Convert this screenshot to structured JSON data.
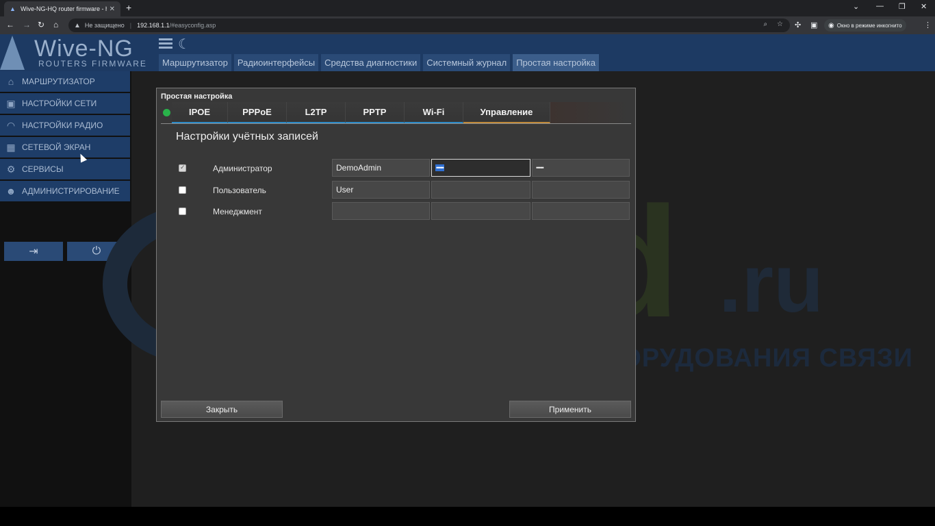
{
  "browser": {
    "tab_title": "Wive-NG-HQ router firmware - h",
    "address": {
      "security": "Не защищено",
      "host": "192.168.1.1",
      "path": "/#easyconfig.asp"
    },
    "incognito_label": "Окно в режиме инкогнито"
  },
  "logo": {
    "main": "Wive-NG",
    "sub": "ROUTERS FIRMWARE"
  },
  "topnav": [
    {
      "label": "Маршрутизатор"
    },
    {
      "label": "Радиоинтерфейсы"
    },
    {
      "label": "Средства диагностики"
    },
    {
      "label": "Системный журнал"
    },
    {
      "label": "Простая настройка"
    }
  ],
  "sidebar": {
    "items": [
      {
        "label": "МАРШРУТИЗАТОР",
        "icon": "home-icon"
      },
      {
        "label": "НАСТРОЙКИ СЕТИ",
        "icon": "network-icon"
      },
      {
        "label": "НАСТРОЙКИ РАДИО",
        "icon": "wifi-icon"
      },
      {
        "label": "СЕТЕВОЙ ЭКРАН",
        "icon": "firewall-icon"
      },
      {
        "label": "СЕРВИСЫ",
        "icon": "gear-icon"
      },
      {
        "label": "АДМИНИСТРИРОВАНИЕ",
        "icon": "admin-icon"
      }
    ]
  },
  "watermark": {
    "brand": "wmd",
    "tld": ".ru",
    "tagline": "ДИСТРИБЬЮТОР ОБОРУДОВАНИЯ СВЯЗИ"
  },
  "dialog": {
    "title": "Простая настройка",
    "tabs": [
      {
        "label": "IPOE"
      },
      {
        "label": "PPPoE"
      },
      {
        "label": "L2TP"
      },
      {
        "label": "PPTP"
      },
      {
        "label": "Wi-Fi"
      },
      {
        "label": "Управление"
      }
    ],
    "active_tab": "Управление",
    "heading": "Настройки учётных записей",
    "accounts": [
      {
        "label": "Администратор",
        "checked": true,
        "login": "DemoAdmin",
        "password": "•••••",
        "confirm": "•••••"
      },
      {
        "label": "Пользователь",
        "checked": false,
        "login": "User",
        "password": "",
        "confirm": ""
      },
      {
        "label": "Менеджмент",
        "checked": false,
        "login": "",
        "password": "",
        "confirm": ""
      }
    ],
    "close_label": "Закрыть",
    "apply_label": "Применить"
  },
  "colors": {
    "header": "#1d3a63",
    "sidebar_item": "#1e3d68",
    "status_ok": "#29b34a",
    "tab_underline": "#2e8cc8",
    "active_tab_underline": "#c08a3c"
  }
}
